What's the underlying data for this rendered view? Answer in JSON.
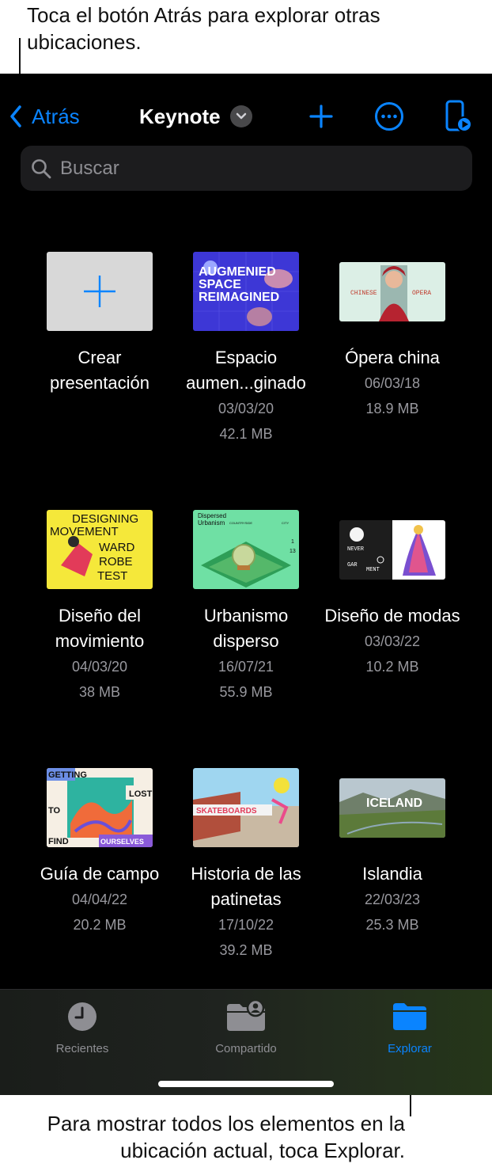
{
  "annotations": {
    "top": "Toca el botón Atrás para explorar otras ubicaciones.",
    "bottom": "Para mostrar todos los elementos en la ubicación actual, toca Explorar."
  },
  "nav": {
    "back_label": "Atrás",
    "title": "Keynote"
  },
  "search": {
    "placeholder": "Buscar"
  },
  "files": [
    {
      "name": "Crear presentación",
      "date": "",
      "size": ""
    },
    {
      "name": "Espacio aumen...ginado",
      "date": "03/03/20",
      "size": "42.1 MB",
      "thumb_text": [
        "AUGMENIED",
        "SPACE",
        "REIMAGINED"
      ]
    },
    {
      "name": "Ópera china",
      "date": "06/03/18",
      "size": "18.9 MB",
      "thumb_text": [
        "CHINESE",
        "OPERA"
      ]
    },
    {
      "name": "Diseño del movimiento",
      "date": "04/03/20",
      "size": "38 MB",
      "thumb_text": [
        "DESIGNING",
        "MOVEMENT",
        "WARD",
        "ROBE",
        "TEST"
      ]
    },
    {
      "name": "Urbanismo disperso",
      "date": "16/07/21",
      "size": "55.9 MB",
      "thumb_text": [
        "Dispersed",
        "Urbanism",
        "COUNTRYSIDE",
        "CITY",
        "1",
        "13"
      ]
    },
    {
      "name": "Diseño de modas",
      "date": "03/03/22",
      "size": "10.2 MB",
      "thumb_text": [
        "NEVER",
        "GAR",
        "MENT"
      ]
    },
    {
      "name": "Guía de campo",
      "date": "04/04/22",
      "size": "20.2 MB",
      "thumb_text": [
        "GETTING",
        "LOST",
        "TO",
        "FIND",
        "OURSELVES"
      ]
    },
    {
      "name": "Historia de las patinetas",
      "date": "17/10/22",
      "size": "39.2 MB",
      "thumb_text": [
        "SKATEBOARDS"
      ]
    },
    {
      "name": "Islandia",
      "date": "22/03/23",
      "size": "25.3 MB",
      "thumb_text": [
        "ICELAND"
      ]
    }
  ],
  "tabbar": {
    "items": [
      {
        "label": "Recientes",
        "icon": "clock-icon"
      },
      {
        "label": "Compartido",
        "icon": "shared-folder-icon"
      },
      {
        "label": "Explorar",
        "icon": "folder-icon",
        "active": true
      }
    ]
  },
  "colors": {
    "accent": "#0a84ff",
    "background": "#000000",
    "secondary_text": "#98989e"
  }
}
